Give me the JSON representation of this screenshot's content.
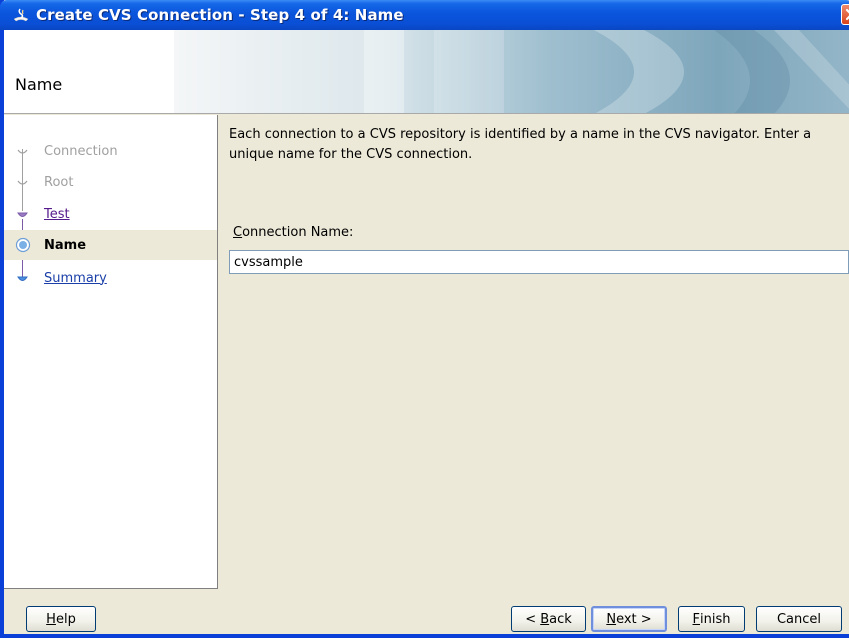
{
  "window": {
    "title": "Create CVS Connection - Step 4 of 4: Name"
  },
  "header": {
    "title": "Name"
  },
  "nav": {
    "items": [
      {
        "label": "Connection",
        "state": "disabled"
      },
      {
        "label": "Root",
        "state": "disabled"
      },
      {
        "label": "Test",
        "state": "visited"
      },
      {
        "label": "Name",
        "state": "current"
      },
      {
        "label": "Summary",
        "state": "link"
      }
    ]
  },
  "main": {
    "description": "Each connection to a CVS repository is identified by a name in the CVS navigator. Enter a unique name for the CVS connection.",
    "field_label_first": "C",
    "field_label_rest": "onnection Name:",
    "connection_name_value": "cvssample"
  },
  "buttons": {
    "help": {
      "mnemonic": "H",
      "rest": "elp"
    },
    "back": {
      "prefix": "< ",
      "mnemonic": "B",
      "rest": "ack"
    },
    "next": {
      "mnemonic": "N",
      "rest": "ext >"
    },
    "finish": {
      "mnemonic": "F",
      "rest": "inish"
    },
    "cancel": "Cancel"
  },
  "colors": {
    "title_bar": "#0a55dc",
    "window_bg": "#ece9d8",
    "visited_link": "#551a8b",
    "link": "#1a3fa8",
    "disabled_text": "#a0a0a0"
  },
  "icons": [
    "app-icon",
    "close-icon"
  ]
}
